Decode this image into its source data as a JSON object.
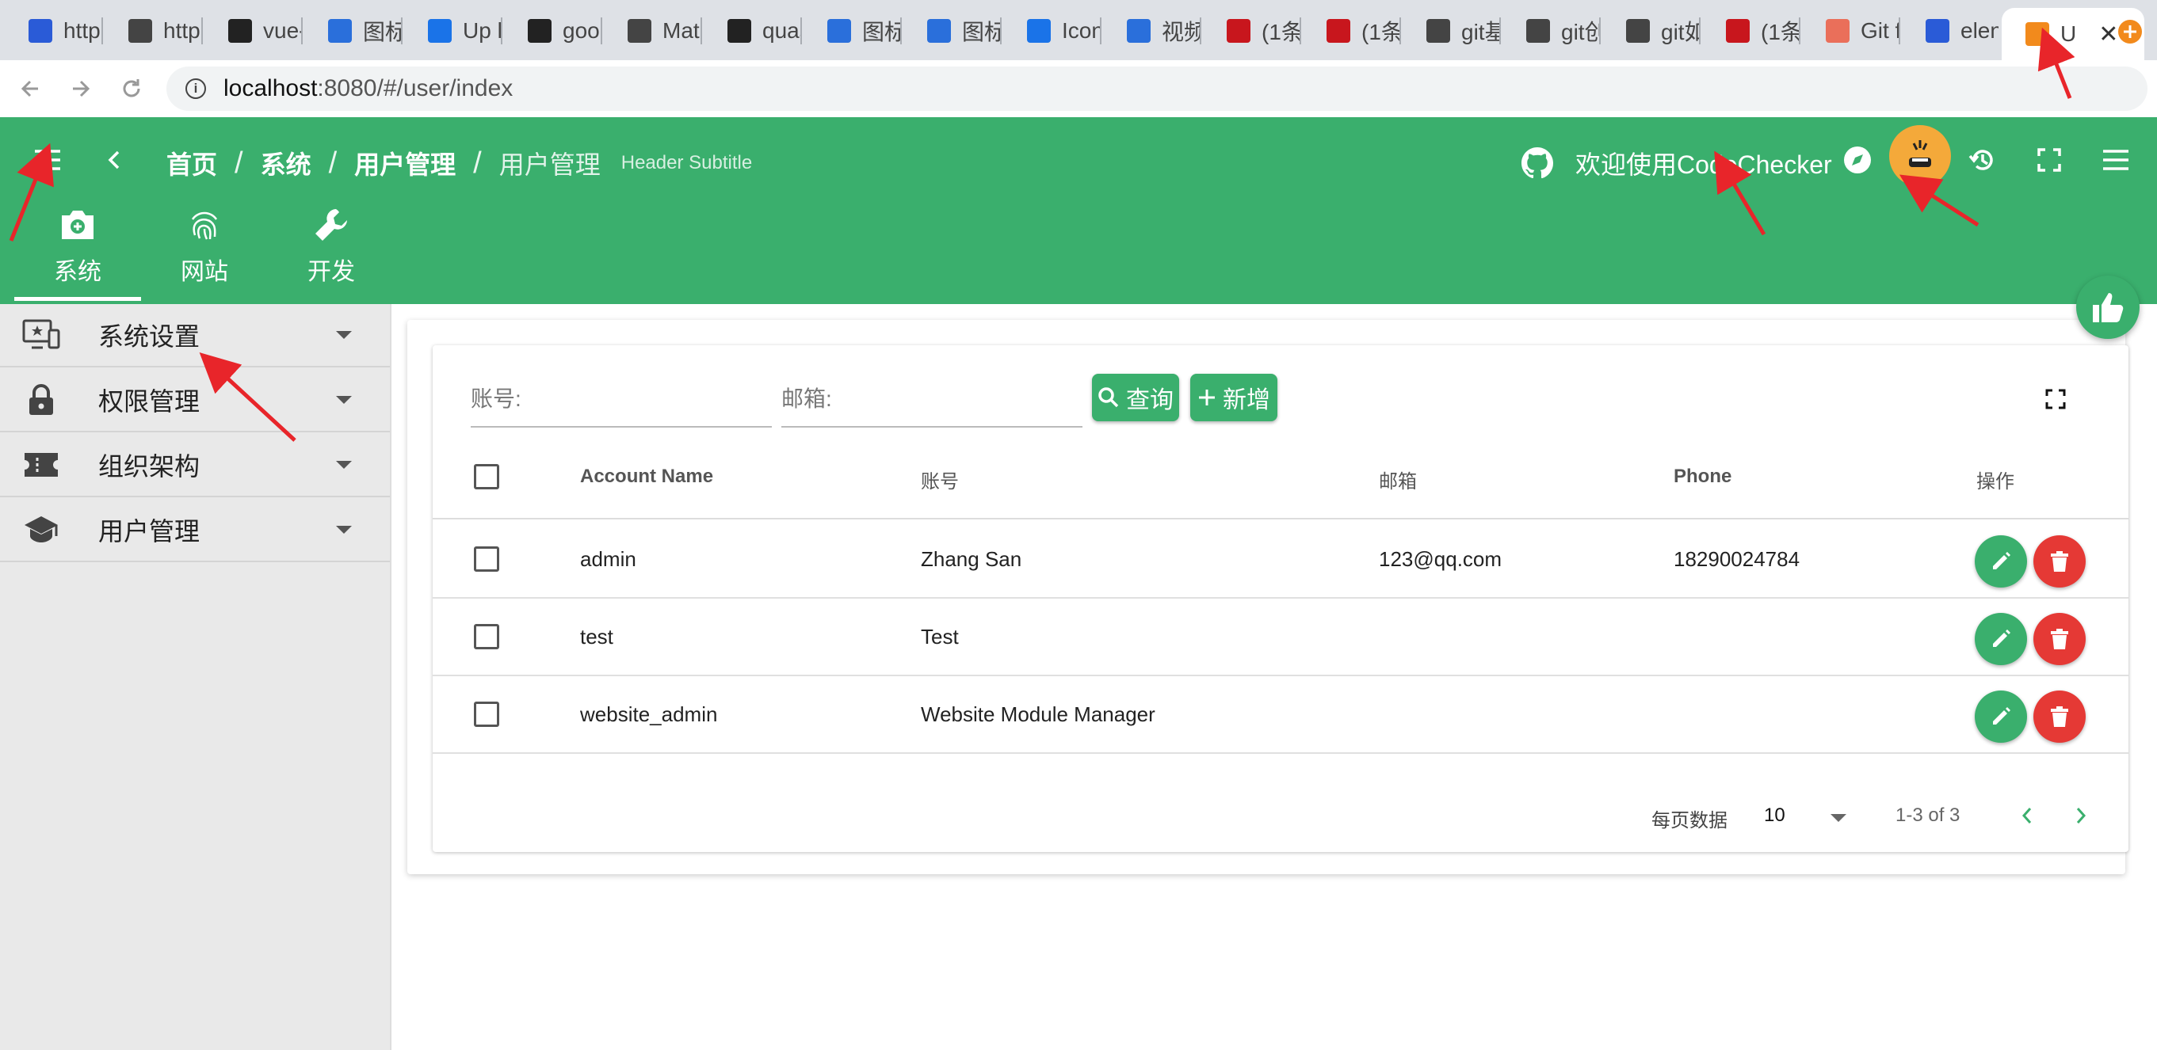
{
  "browser": {
    "tabs": [
      {
        "label": "http",
        "favicon": "baidu-icon",
        "color": "#2a5bd7"
      },
      {
        "label": "http",
        "favicon": "sign-icon",
        "color": "#444444"
      },
      {
        "label": "vue-",
        "favicon": "github-icon",
        "color": "#222222"
      },
      {
        "label": "图标",
        "favicon": "iconfont-icon",
        "color": "#2a6fdb"
      },
      {
        "label": "Up l",
        "favicon": "flag-icon",
        "color": "#1a73e8"
      },
      {
        "label": "goo",
        "favicon": "github-icon",
        "color": "#222222"
      },
      {
        "label": "Mat",
        "favicon": "globe-icon",
        "color": "#444444"
      },
      {
        "label": "quas",
        "favicon": "github-icon",
        "color": "#222222"
      },
      {
        "label": "图标",
        "favicon": "iconfont-icon",
        "color": "#2a6fdb"
      },
      {
        "label": "图标",
        "favicon": "iconfont-icon",
        "color": "#2a6fdb"
      },
      {
        "label": "Icon",
        "favicon": "flag-icon",
        "color": "#1a73e8"
      },
      {
        "label": "视频",
        "favicon": "iconfont-icon",
        "color": "#2a6fdb"
      },
      {
        "label": "(1条",
        "favicon": "csdn-icon",
        "color": "#c8161d"
      },
      {
        "label": "(1条",
        "favicon": "csdn-icon",
        "color": "#c8161d"
      },
      {
        "label": "git基",
        "favicon": "sign-icon",
        "color": "#444444"
      },
      {
        "label": "git创",
        "favicon": "sign-icon",
        "color": "#444444"
      },
      {
        "label": "git如",
        "favicon": "sign-icon",
        "color": "#444444"
      },
      {
        "label": "(1条",
        "favicon": "csdn-icon",
        "color": "#c8161d"
      },
      {
        "label": "Git f",
        "favicon": "jianshu-icon",
        "color": "#ea6f5a"
      },
      {
        "label": "elen",
        "favicon": "baidu-icon",
        "color": "#2a5bd7"
      },
      {
        "label": "U",
        "favicon": "quasar-icon",
        "color": "#f28a1c"
      }
    ],
    "url_host": "localhost",
    "url_rest": ":8080/#/user/index"
  },
  "header": {
    "breadcrumbs": [
      "首页",
      "系统",
      "用户管理",
      "用户管理"
    ],
    "subtitle": "Header Subtitle",
    "welcome": "欢迎使用CodeChecker",
    "modules": [
      {
        "label": "系统",
        "icon": "camera-plus-icon"
      },
      {
        "label": "网站",
        "icon": "fingerprint-icon"
      },
      {
        "label": "开发",
        "icon": "wrench-icon"
      }
    ]
  },
  "sidebar": {
    "items": [
      {
        "label": "系统设置",
        "icon": "monitor-settings-icon"
      },
      {
        "label": "权限管理",
        "icon": "lock-icon"
      },
      {
        "label": "组织架构",
        "icon": "ticket-icon"
      },
      {
        "label": "用户管理",
        "icon": "school-icon"
      }
    ]
  },
  "search": {
    "account_label": "账号:",
    "email_label": "邮箱:",
    "query_button": "查询",
    "add_button": "新增"
  },
  "table": {
    "columns": [
      "Account Name",
      "账号",
      "邮箱",
      "Phone",
      "操作"
    ],
    "rows": [
      {
        "account": "admin",
        "name": "Zhang San",
        "email": "123@qq.com",
        "phone": "18290024784"
      },
      {
        "account": "test",
        "name": "Test",
        "email": "",
        "phone": ""
      },
      {
        "account": "website_admin",
        "name": "Website Module Manager",
        "email": "",
        "phone": ""
      }
    ]
  },
  "pagination": {
    "rows_per_page_label": "每页数据",
    "rows_per_page": "10",
    "range": "1-3 of 3"
  },
  "colors": {
    "primary": "#3aaf6d",
    "danger": "#e53935",
    "annotation": "#e8252a"
  }
}
